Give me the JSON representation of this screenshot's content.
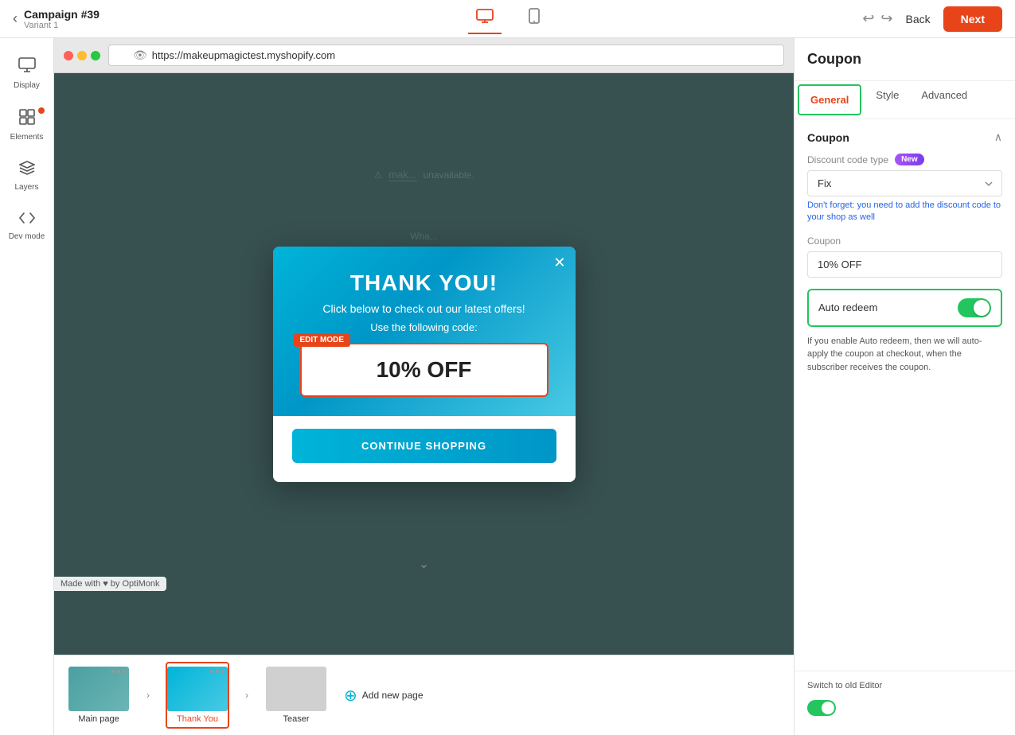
{
  "topbar": {
    "back_label": "Back",
    "next_label": "Next",
    "campaign_title": "Campaign #39",
    "campaign_sub": "Variant 1",
    "undo_icon": "↩",
    "redo_icon": "↪"
  },
  "browser": {
    "url": "https://makeupmagictest.myshopify.com"
  },
  "sidebar": {
    "items": [
      {
        "id": "display",
        "label": "Display",
        "icon": "🖥"
      },
      {
        "id": "elements",
        "label": "Elements",
        "icon": "⊞",
        "has_dot": true
      },
      {
        "id": "layers",
        "label": "Layers",
        "icon": "☰"
      },
      {
        "id": "devmode",
        "label": "Dev mode",
        "icon": "<>"
      }
    ]
  },
  "modal": {
    "title": "THANK YOU!",
    "subtitle": "Click below to check out our latest offers!",
    "code_label": "Use the following code:",
    "coupon_code": "10% OFF",
    "cta_label": "CONTINUE SHOPPING",
    "edit_mode_badge": "EDIT MODE",
    "close_icon": "✕"
  },
  "thumbnails": {
    "pages": [
      {
        "id": "main-page",
        "label": "Main page",
        "active": false
      },
      {
        "id": "thank-you",
        "label": "Thank You",
        "active": true
      },
      {
        "id": "teaser",
        "label": "Teaser",
        "active": false
      }
    ],
    "add_label": "Add new page"
  },
  "made_with": "Made with ♥ by OptiMonk",
  "right_panel": {
    "title": "Coupon",
    "tabs": [
      {
        "id": "general",
        "label": "General",
        "active": true
      },
      {
        "id": "style",
        "label": "Style",
        "active": false
      },
      {
        "id": "advanced",
        "label": "Advanced",
        "active": false
      }
    ],
    "section_title": "Coupon",
    "discount_code_type_label": "Discount code type",
    "new_badge": "New",
    "dropdown_value": "Fix",
    "hint_text": "Don't forget: you need to add the discount code to your shop as well",
    "coupon_field_label": "Coupon",
    "coupon_value": "10% OFF",
    "auto_redeem_label": "Auto redeem",
    "auto_redeem_hint": "If you enable Auto redeem, then we will auto-apply the coupon at checkout, when the subscriber receives the coupon.",
    "auto_redeem_enabled": true
  },
  "bottom_switch": {
    "label": "Switch to old Editor"
  }
}
